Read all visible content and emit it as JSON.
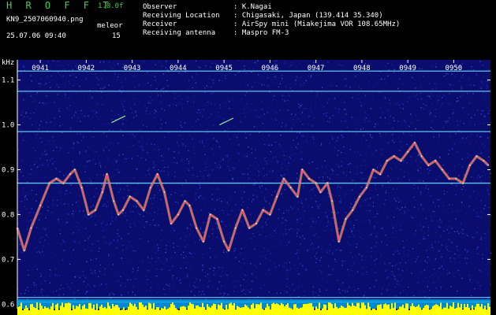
{
  "header": {
    "brand": "H R O F F T",
    "version": "1.0.0f",
    "filename": "KN9_2507060940.png",
    "datetime": "25.07.06 09:40",
    "meleor_label": "meleor",
    "meleor_count": "15",
    "fields": [
      {
        "label": "Observer",
        "value": ": K.Nagai"
      },
      {
        "label": "Receiving Location",
        "value": ": Chigasaki, Japan (139.414 35.340)"
      },
      {
        "label": "Receiver",
        "value": ": AirSpy mini (Miakejima VOR 108.65MHz)"
      },
      {
        "label": "Receiving antenna",
        "value": ": Maspro FM-3"
      }
    ]
  },
  "chart_data": {
    "type": "line",
    "ylabel": "kHz",
    "x_ticks": [
      "0941",
      "0942",
      "0943",
      "0944",
      "0945",
      "0946",
      "0947",
      "0948",
      "0949",
      "0950"
    ],
    "y_ticks": [
      "1.1",
      "1.0",
      "0.9",
      "0.8",
      "0.7",
      "0.6"
    ],
    "ylim": [
      0.59,
      1.145
    ],
    "xlim": [
      0,
      10.3
    ],
    "horizontal_lines_khz": [
      1.12,
      1.075,
      0.985,
      0.87,
      0.615,
      0.605
    ],
    "meteor_streaks": [
      {
        "x": [
          2.05,
          2.35
        ],
        "y": [
          1.005,
          1.02
        ]
      },
      {
        "x": [
          4.4,
          4.7
        ],
        "y": [
          1.0,
          1.015
        ]
      }
    ],
    "signal": {
      "name": "",
      "x": [
        0.0,
        0.15,
        0.3,
        0.5,
        0.7,
        0.85,
        1.0,
        1.15,
        1.25,
        1.4,
        1.55,
        1.7,
        1.85,
        1.95,
        2.1,
        2.2,
        2.3,
        2.45,
        2.6,
        2.75,
        2.9,
        3.05,
        3.2,
        3.35,
        3.5,
        3.65,
        3.75,
        3.9,
        4.05,
        4.2,
        4.35,
        4.5,
        4.6,
        4.75,
        4.9,
        5.05,
        5.2,
        5.35,
        5.5,
        5.65,
        5.8,
        5.95,
        6.1,
        6.2,
        6.35,
        6.5,
        6.6,
        6.75,
        6.85,
        7.0,
        7.15,
        7.3,
        7.45,
        7.6,
        7.75,
        7.9,
        8.05,
        8.2,
        8.35,
        8.5,
        8.65,
        8.8,
        8.95,
        9.1,
        9.25,
        9.4,
        9.55,
        9.7,
        9.85,
        10.0,
        10.15,
        10.25
      ],
      "y": [
        0.77,
        0.72,
        0.77,
        0.82,
        0.87,
        0.88,
        0.87,
        0.89,
        0.9,
        0.86,
        0.8,
        0.81,
        0.85,
        0.89,
        0.83,
        0.8,
        0.81,
        0.84,
        0.83,
        0.81,
        0.86,
        0.89,
        0.85,
        0.78,
        0.8,
        0.83,
        0.82,
        0.77,
        0.74,
        0.8,
        0.79,
        0.74,
        0.72,
        0.77,
        0.81,
        0.77,
        0.78,
        0.81,
        0.8,
        0.84,
        0.88,
        0.86,
        0.84,
        0.9,
        0.88,
        0.87,
        0.85,
        0.87,
        0.83,
        0.74,
        0.79,
        0.81,
        0.84,
        0.86,
        0.9,
        0.89,
        0.92,
        0.93,
        0.92,
        0.94,
        0.96,
        0.93,
        0.91,
        0.92,
        0.9,
        0.88,
        0.88,
        0.87,
        0.91,
        0.93,
        0.92,
        0.91
      ]
    },
    "colors": {
      "background": "#0a0d6e",
      "line_markers": "#6fe6ff",
      "signal": "#ff4d7a",
      "signal_halo": "#c9e84a",
      "tick_text": "#ffffff",
      "bottom_bar": "#ffff00",
      "bottom_band": "#00a8e8"
    }
  }
}
